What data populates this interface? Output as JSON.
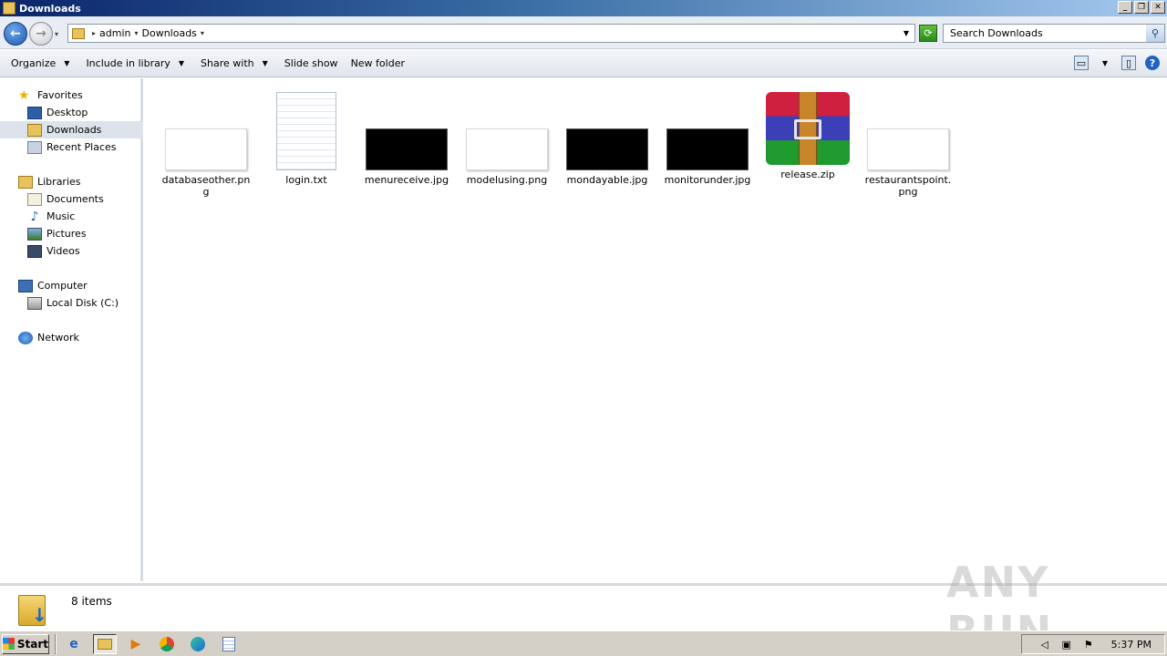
{
  "window": {
    "title": "Downloads"
  },
  "address": {
    "crumbs": [
      "admin",
      "Downloads"
    ]
  },
  "search": {
    "placeholder": "Search Downloads"
  },
  "toolbar": {
    "organize": "Organize",
    "include_library": "Include in library",
    "share_with": "Share with",
    "slide_show": "Slide show",
    "new_folder": "New folder"
  },
  "nav": {
    "favorites": "Favorites",
    "desktop": "Desktop",
    "downloads": "Downloads",
    "recent_places": "Recent Places",
    "libraries": "Libraries",
    "documents": "Documents",
    "music": "Music",
    "pictures": "Pictures",
    "videos": "Videos",
    "computer": "Computer",
    "local_disk": "Local Disk (C:)",
    "network": "Network"
  },
  "files": [
    {
      "name": "databaseother.png",
      "kind": "image-light"
    },
    {
      "name": "login.txt",
      "kind": "text"
    },
    {
      "name": "menureceive.jpg",
      "kind": "image-dark"
    },
    {
      "name": "modelusing.png",
      "kind": "image-light"
    },
    {
      "name": "mondayable.jpg",
      "kind": "image-dark"
    },
    {
      "name": "monitorunder.jpg",
      "kind": "image-dark"
    },
    {
      "name": "release.zip",
      "kind": "archive"
    },
    {
      "name": "restaurantspoint.png",
      "kind": "image-light"
    }
  ],
  "status": {
    "count": "8 items"
  },
  "watermark": "ANY RUN",
  "taskbar": {
    "start": "Start",
    "clock": "5:37 PM"
  }
}
